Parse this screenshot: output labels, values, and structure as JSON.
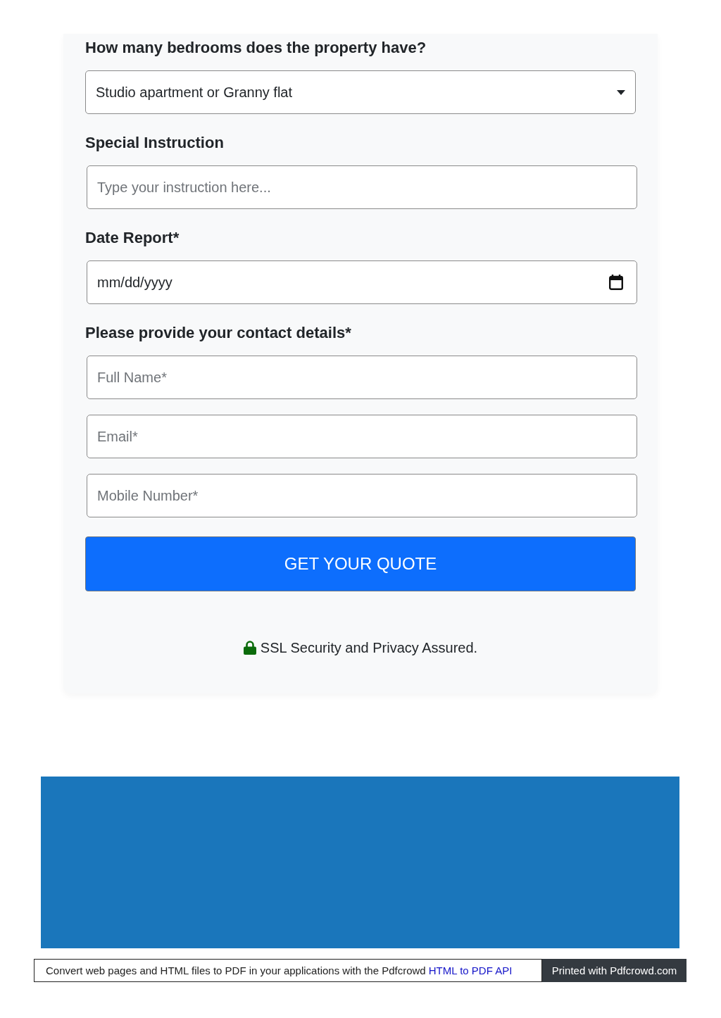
{
  "form": {
    "sections": [
      {
        "label": "How many bedrooms does the property have?",
        "fields": [
          {
            "kind": "select",
            "value": "Studio apartment or Granny flat"
          }
        ]
      },
      {
        "label": "Special Instruction",
        "fields": [
          {
            "kind": "text",
            "placeholder": "Type your instruction here..."
          }
        ]
      },
      {
        "label": "Date Report*",
        "fields": [
          {
            "kind": "date",
            "value": "mm/dd/yyyy"
          }
        ]
      },
      {
        "label": "Please provide your contact details*",
        "fields": [
          {
            "kind": "text",
            "placeholder": "Full Name*"
          },
          {
            "kind": "text",
            "placeholder": "Email*"
          },
          {
            "kind": "text",
            "placeholder": "Mobile Number*"
          }
        ]
      }
    ],
    "submit_button": "GET YOUR QUOTE",
    "security_note": "SSL Security and Privacy Assured."
  },
  "pdf_footer": {
    "text": "Convert web pages and HTML files to PDF in your applications with the Pdfcrowd",
    "link": "HTML to PDF API",
    "printed_with": "Printed with Pdfcrowd.com"
  }
}
